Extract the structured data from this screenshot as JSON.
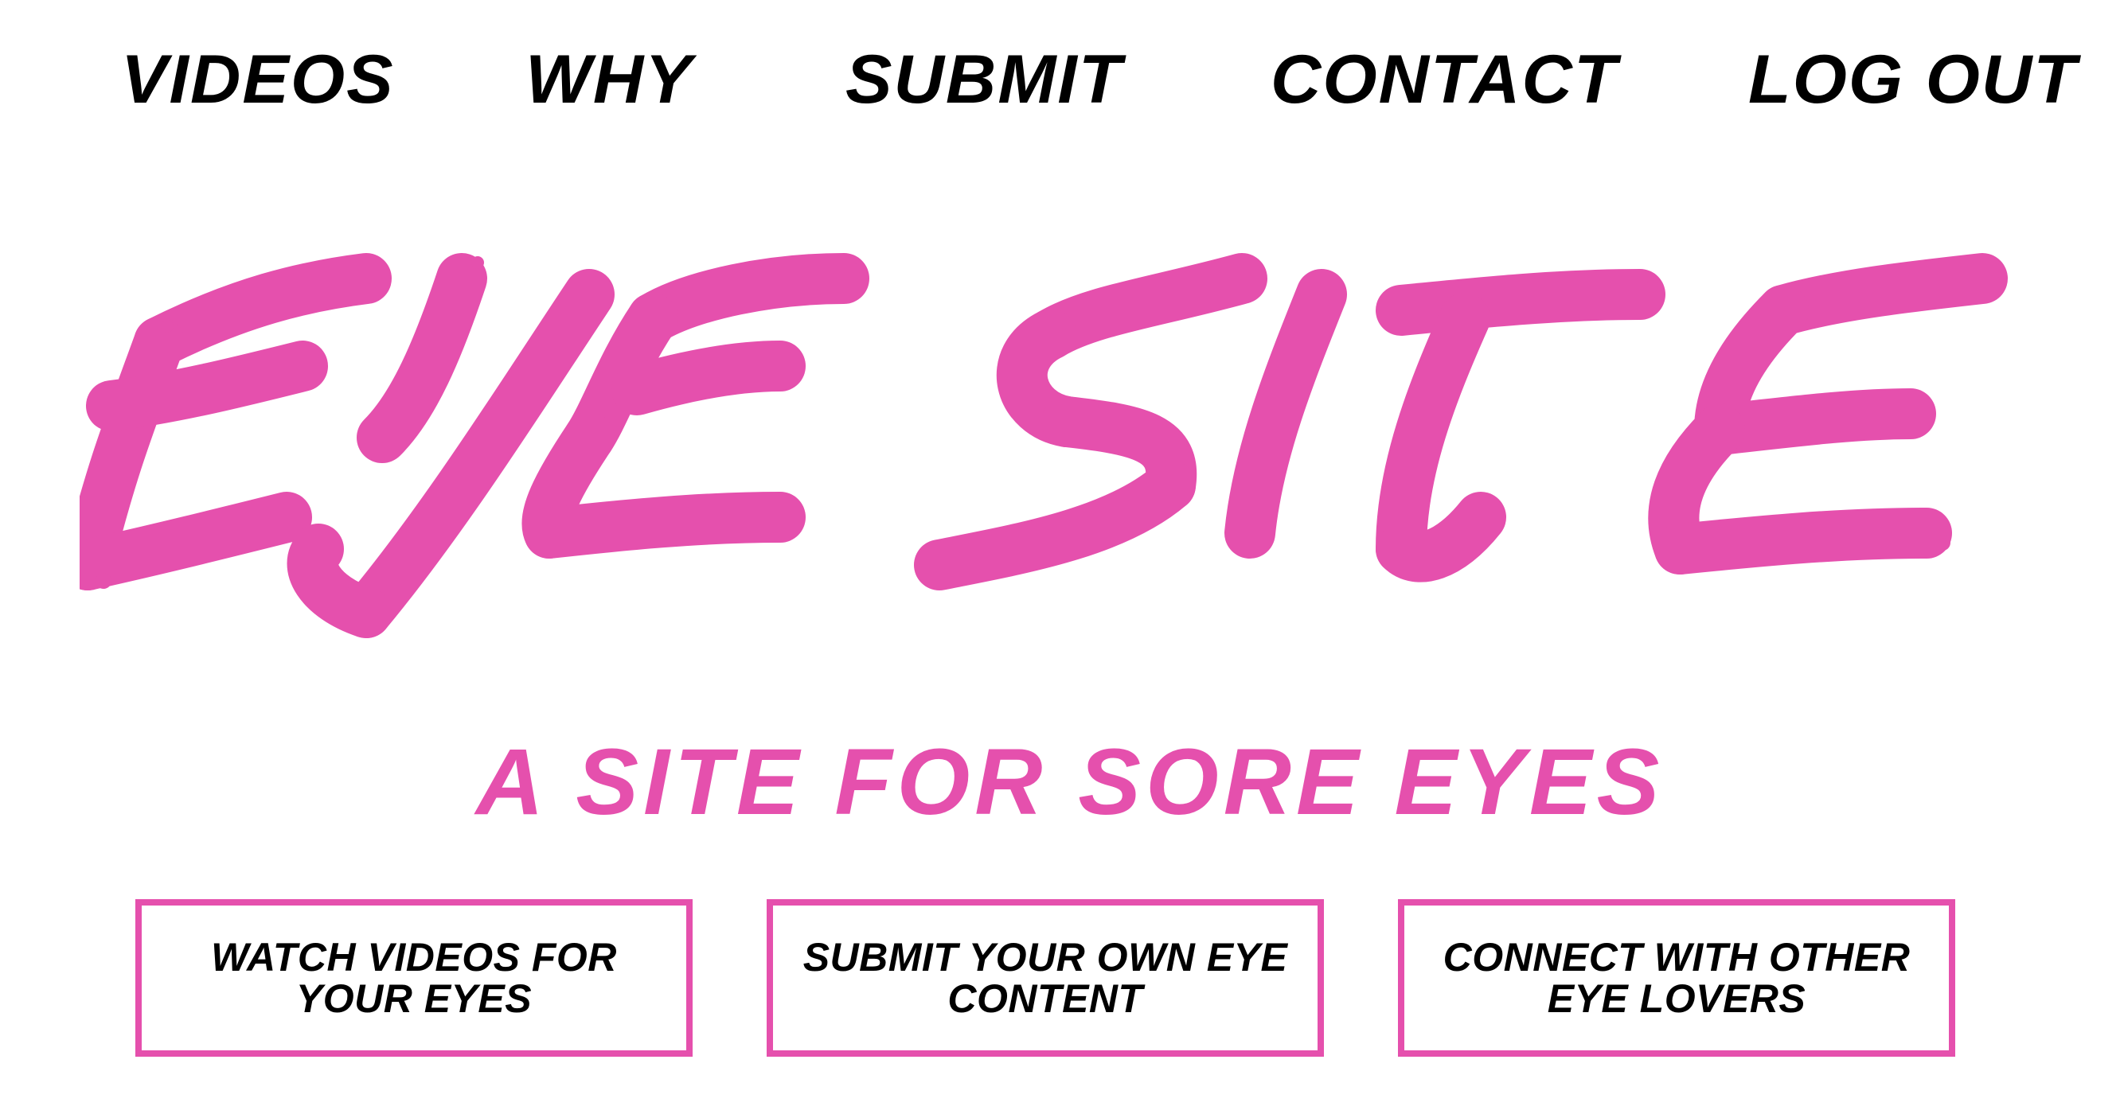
{
  "nav": {
    "items": [
      {
        "label": "VIDEOS"
      },
      {
        "label": "WHY"
      },
      {
        "label": "SUBMIT"
      },
      {
        "label": "CONTACT"
      },
      {
        "label": "LOG OUT"
      }
    ]
  },
  "hero": {
    "logo_text": "EYE SITE",
    "tagline": "A SITE FOR SORE EYES"
  },
  "cta": {
    "items": [
      {
        "label": "WATCH VIDEOS FOR YOUR EYES"
      },
      {
        "label": "SUBMIT YOUR OWN EYE CONTENT"
      },
      {
        "label": "CONNECT WITH OTHER EYE LOVERS"
      }
    ]
  },
  "colors": {
    "brand_pink": "#e550ad",
    "nav_text": "#000000",
    "background": "#ffffff"
  }
}
